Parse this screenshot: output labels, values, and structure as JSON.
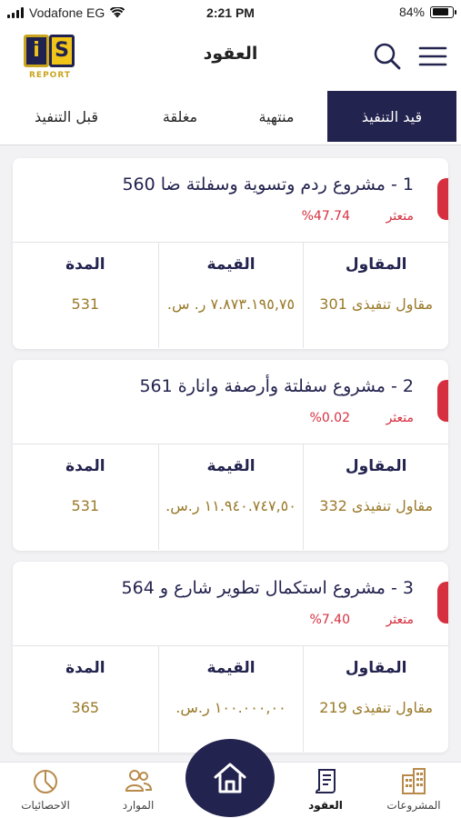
{
  "status_bar": {
    "carrier": "Vodafone EG",
    "time": "2:21 PM",
    "battery": "84%",
    "battery_level": 0.84
  },
  "header": {
    "title": "العقود",
    "logo_text": "REPORT",
    "logo_letters": [
      "i",
      "S"
    ]
  },
  "tabs": [
    {
      "label": "قيد التنفيذ",
      "active": true
    },
    {
      "label": "منتهية",
      "active": false
    },
    {
      "label": "مغلقة",
      "active": false
    },
    {
      "label": "قبل التنفيذ",
      "active": false
    }
  ],
  "columns": {
    "contractor": "المقاول",
    "value": "القيمة",
    "duration": "المدة"
  },
  "contracts": [
    {
      "title": "1 - مشروع ردم وتسوية وسفلتة ضا 560",
      "status": "متعثر",
      "percent": "%47.74",
      "contractor": "مقاول تنفيذى 301",
      "value": "٧.٨٧٣.١٩٥,٧٥ ر. س.",
      "duration": "531"
    },
    {
      "title": "2 - مشروع سفلتة وأرصفة وانارة 561",
      "status": "متعثر",
      "percent": "%0.02",
      "contractor": "مقاول تنفيذى 332",
      "value": "١١.٩٤٠.٧٤٧,٥٠ ر.س.",
      "duration": "531"
    },
    {
      "title": "3 - مشروع استكمال تطوير شارع و 564",
      "status": "متعثر",
      "percent": "%7.40",
      "contractor": "مقاول تنفيذى 219",
      "value": "١٠٠.٠٠٠,٠٠ ر.س.",
      "duration": "365"
    }
  ],
  "bottom_nav": [
    {
      "label": "المشروعات",
      "icon": "buildings-icon"
    },
    {
      "label": "العقود",
      "icon": "contract-icon",
      "active": true
    },
    {
      "label": "home",
      "icon": "home-icon"
    },
    {
      "label": "الموارد",
      "icon": "people-icon"
    },
    {
      "label": "الاحصائيات",
      "icon": "chart-icon"
    }
  ],
  "colors": {
    "brand_navy": "#23234f",
    "accent_red": "#d63040",
    "value_gold": "#9a7a2a",
    "logo_gold": "#c9a51e"
  }
}
